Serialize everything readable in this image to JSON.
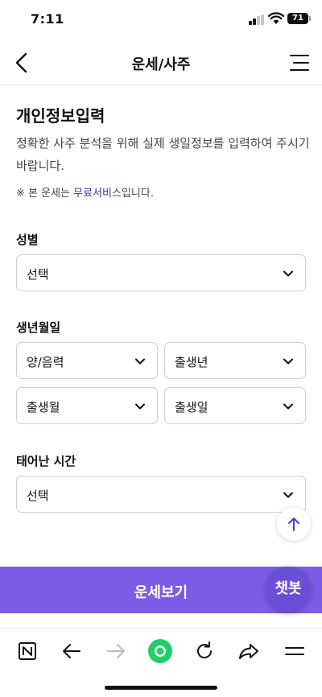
{
  "status": {
    "time": "7:11",
    "battery": "71"
  },
  "header": {
    "title": "운세/사주"
  },
  "form": {
    "title": "개인정보입력",
    "description": "정확한 사주 분석을 위해 실제 생일정보를 입력하여 주시기 바랍니다.",
    "notice_prefix": "※ 본 운세는 ",
    "notice_highlight": "무료서비스",
    "notice_suffix": "입니다.",
    "gender": {
      "label": "성별",
      "value": "선택"
    },
    "birth": {
      "label": "생년월일",
      "calendar": "양/음력",
      "year": "출생년",
      "month": "출생월",
      "day": "출생일"
    },
    "time": {
      "label": "태어난 시간",
      "value": "선택"
    }
  },
  "cta": {
    "label": "운세보기",
    "chatbot": "챗봇"
  },
  "colors": {
    "accent": "#7c5ce6",
    "link": "#3a2fa8",
    "go": "#1fcf6a"
  }
}
